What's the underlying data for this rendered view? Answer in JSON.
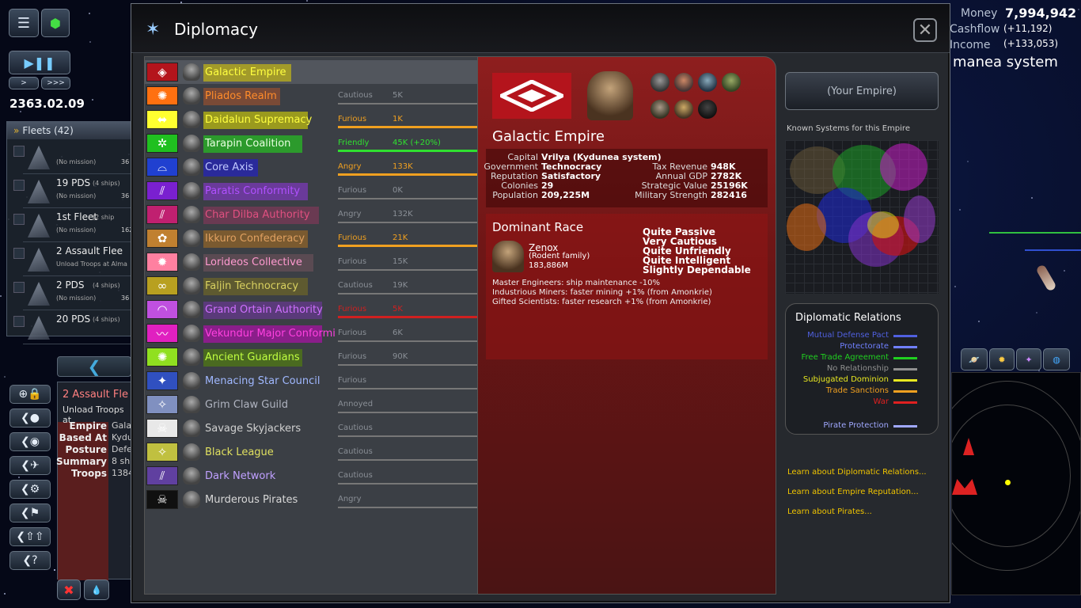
{
  "hud": {
    "date": "2363.02.09",
    "speed_normal": ">",
    "speed_fast": ">>>",
    "money_label": "Money",
    "money_value": "7,994,942",
    "cashflow_label": "Cashflow",
    "cashflow_value": "(+11,192)",
    "income_label": "Income",
    "income_value": "(+133,053)",
    "system_name": "manea system"
  },
  "fleets": {
    "header": "Fleets (42)",
    "items": [
      {
        "name": "",
        "ships": "",
        "mission": "(No mission)",
        "value": "36"
      },
      {
        "name": "19 PDS",
        "ships": "(4 ships)",
        "mission": "(No mission)",
        "value": "36"
      },
      {
        "name": "1st Fleet",
        "ships": "(2 ship",
        "mission": "(No mission)",
        "value": "162"
      },
      {
        "name": "2 Assault Flee",
        "ships": "",
        "mission": "Unload Troops at Alma",
        "value": ""
      },
      {
        "name": "2 PDS",
        "ships": "(4 ships)",
        "mission": "(No mission)",
        "value": "36"
      },
      {
        "name": "20 PDS",
        "ships": "(4 ships)",
        "mission": "",
        "value": ""
      }
    ]
  },
  "selected": {
    "title": "2 Assault Fle",
    "subtitle": "Unload Troops at",
    "rows": [
      {
        "k": "Empire",
        "v": "Galac"
      },
      {
        "k": "Based At",
        "v": "Kydu"
      },
      {
        "k": "Posture",
        "v": "Defe"
      },
      {
        "k": "Summary",
        "v": "8 sh"
      },
      {
        "k": "Troops",
        "v": "1384"
      }
    ]
  },
  "window": {
    "title": "Diplomacy",
    "close": "✕"
  },
  "empires": [
    {
      "name": "Galactic Empire",
      "color": "#ffff40",
      "bg": "#a29a2a",
      "flag": "#b4141c",
      "rel": "",
      "val": "",
      "relcolor": "#aaa",
      "fill": 0
    },
    {
      "name": "Pliados Realm",
      "color": "#ff8c2a",
      "bg": "#7a4a36",
      "flag": "#ff7010",
      "rel": "Cautious",
      "val": "5K",
      "relcolor": "#8a8f96",
      "fill": 0
    },
    {
      "name": "Daidalun Supremacy",
      "color": "#ffff40",
      "bg": "#9a9a1e",
      "flag": "#ffff30",
      "rel": "Furious",
      "val": "1K",
      "relcolor": "#f0a020",
      "fill": 1
    },
    {
      "name": "Tarapin Coalition",
      "color": "#e8ffe0",
      "bg": "#2c9a2c",
      "flag": "#20c020",
      "rel": "Friendly",
      "val": "45K (+20%)",
      "relcolor": "#30e030",
      "fill": 1
    },
    {
      "name": "Core Axis",
      "color": "#c0c8ff",
      "bg": "#2a2a9a",
      "flag": "#2040d0",
      "rel": "Angry",
      "val": "133K",
      "relcolor": "#f0a020",
      "fill": 1
    },
    {
      "name": "Paratis Conformity",
      "color": "#b050ff",
      "bg": "#6a3a9a",
      "flag": "#7a20d0",
      "rel": "Furious",
      "val": "0K",
      "relcolor": "#8a8f96",
      "fill": 0
    },
    {
      "name": "Char Dilba Authority",
      "color": "#e05080",
      "bg": "#6a3a52",
      "flag": "#c02070",
      "rel": "Angry",
      "val": "132K",
      "relcolor": "#8a8f96",
      "fill": 0
    },
    {
      "name": "Ikkuro Confederacy",
      "color": "#e0a060",
      "bg": "#7a5a30",
      "flag": "#c08030",
      "rel": "Furious",
      "val": "21K",
      "relcolor": "#f0a020",
      "fill": 1
    },
    {
      "name": "Lorideos Collective",
      "color": "#ff9ad0",
      "bg": "#5a4a52",
      "flag": "#ff80a0",
      "rel": "Furious",
      "val": "15K",
      "relcolor": "#8a8f96",
      "fill": 0
    },
    {
      "name": "Faljin Technocracy",
      "color": "#d8d060",
      "bg": "#5e5a30",
      "flag": "#b8a020",
      "rel": "Cautious",
      "val": "19K",
      "relcolor": "#8a8f96",
      "fill": 0
    },
    {
      "name": "Grand Ortain Authority",
      "color": "#d070ff",
      "bg": "#5a3a7a",
      "flag": "#c050e0",
      "rel": "Furious",
      "val": "5K",
      "relcolor": "#d02020",
      "fill": 1
    },
    {
      "name": "Vekundur Major Conformi",
      "color": "#ff40e0",
      "bg": "#8a1e8a",
      "flag": "#e020c0",
      "rel": "Furious",
      "val": "6K",
      "relcolor": "#8a8f96",
      "fill": 0
    },
    {
      "name": "Ancient Guardians",
      "color": "#c0ff40",
      "bg": "#4a6a20",
      "flag": "#90e020",
      "rel": "Furious",
      "val": "90K",
      "relcolor": "#8a8f96",
      "fill": 0
    },
    {
      "name": "Menacing Star Council",
      "color": "#a0b8ff",
      "bg": "",
      "flag": "#3050c0",
      "rel": "Furious",
      "val": "",
      "relcolor": "#8a8f96",
      "fill": 0
    },
    {
      "name": "Grim Claw Guild",
      "color": "#b0b4c0",
      "bg": "",
      "flag": "#8090c0",
      "rel": "Annoyed",
      "val": "",
      "relcolor": "#8a8f96",
      "fill": 0
    },
    {
      "name": "Savage Skyjackers",
      "color": "#d0d0d0",
      "bg": "",
      "flag": "#e8e8e8",
      "rel": "Cautious",
      "val": "",
      "relcolor": "#8a8f96",
      "fill": 0
    },
    {
      "name": "Black League",
      "color": "#e0e060",
      "bg": "",
      "flag": "#c0c040",
      "rel": "Cautious",
      "val": "",
      "relcolor": "#8a8f96",
      "fill": 0
    },
    {
      "name": "Dark Network",
      "color": "#c0a0ff",
      "bg": "",
      "flag": "#6040a0",
      "rel": "Cautious",
      "val": "",
      "relcolor": "#8a8f96",
      "fill": 0
    },
    {
      "name": "Murderous Pirates",
      "color": "#d8d8d8",
      "bg": "",
      "flag": "#101010",
      "rel": "Angry",
      "val": "",
      "relcolor": "#8a8f96",
      "fill": 0
    }
  ],
  "detail": {
    "name": "Galactic Empire",
    "stats_left": [
      {
        "k": "Capital",
        "v": "Vrilya (Kydunea system)"
      },
      {
        "k": "Government",
        "v": "Technocracy"
      },
      {
        "k": "Reputation",
        "v": "Satisfactory"
      },
      {
        "k": "Colonies",
        "v": "29"
      },
      {
        "k": "Population",
        "v": "209,225M"
      }
    ],
    "stats_right": [
      {
        "k": "Tax Revenue",
        "v": "948K"
      },
      {
        "k": "Annual GDP",
        "v": "2782K"
      },
      {
        "k": "Strategic Value",
        "v": "25196K"
      },
      {
        "k": "Military Strength",
        "v": "282416"
      }
    ],
    "race_header": "Dominant Race",
    "race_name": "Zenox",
    "race_family": "(Rodent family)",
    "race_pop": "183,886M",
    "traits": [
      "Quite Passive",
      "Very Cautious",
      "Quite Unfriendly",
      "Quite Intelligent",
      "Slightly Dependable"
    ],
    "bonuses": [
      "Master Engineers: ship maintenance -10%",
      "Industrious Miners: faster mining +1% (from Amonkrie)",
      "Gifted Scientists: faster research +1% (from Amonkrie)"
    ]
  },
  "right": {
    "your_empire": "(Your Empire)",
    "known_label": "Known Systems for this Empire",
    "relations_title": "Diplomatic Relations",
    "legend": [
      {
        "label": "Mutual Defense Pact",
        "color": "#5060e0"
      },
      {
        "label": "Protectorate",
        "color": "#7080ff"
      },
      {
        "label": "Free Trade Agreement",
        "color": "#20d020"
      },
      {
        "label": "No Relationship",
        "color": "#909090"
      },
      {
        "label": "Subjugated Dominion",
        "color": "#e8e820"
      },
      {
        "label": "Trade Sanctions",
        "color": "#f0a020"
      },
      {
        "label": "War",
        "color": "#e02020"
      },
      {
        "label": "Pirate Protection",
        "color": "#a0a8ff"
      }
    ],
    "learn": [
      "Learn about Diplomatic Relations...",
      "Learn about Empire Reputation...",
      "Learn about Pirates..."
    ]
  }
}
